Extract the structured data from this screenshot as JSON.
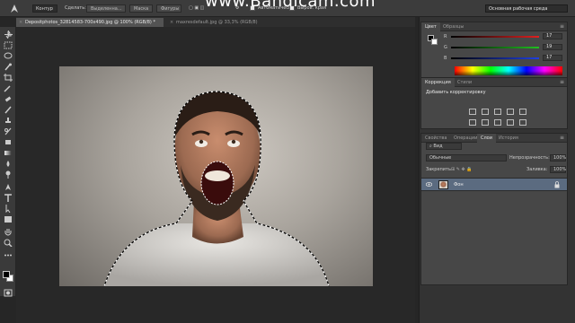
{
  "watermark": "www.Bandicam.com",
  "options_bar": {
    "mode_value": "Контур",
    "make_label": "Сделать:",
    "selection_btn": "Выделенна...",
    "mask_btn": "Маска",
    "shape_btn": "Фигуры",
    "autoadd_label": "Автоматически",
    "align_edges_label": "Выров. края",
    "workspace_value": "Основная рабочая среда"
  },
  "doc_tabs": [
    {
      "label": "Depositphotos_32814583-700x490.jpg @ 100% (RGB/8) *",
      "close": "×"
    },
    {
      "label": "maxresdefault.jpg @ 33,3% (RGB/8)",
      "close": "×"
    }
  ],
  "color_panel": {
    "tabs": [
      "Цвет",
      "Образцы"
    ],
    "channels": [
      {
        "name": "R",
        "value": "17",
        "color": "#e02020"
      },
      {
        "name": "G",
        "value": "19",
        "color": "#20c020"
      },
      {
        "name": "B",
        "value": "17",
        "color": "#2040e0"
      }
    ]
  },
  "adjustments_panel": {
    "tabs": [
      "Коррекция",
      "Стили"
    ],
    "title": "Добавить корректировку"
  },
  "layers_panel": {
    "tabs": [
      "Свойства",
      "Операции",
      "Слои",
      "История"
    ],
    "kind_filter": "Вид",
    "blend_mode": "Обычные",
    "opacity_label": "Непрозрачность:",
    "opacity_value": "100%",
    "lock_label": "Закрепить:",
    "fill_label": "Заливка:",
    "fill_value": "100%",
    "layers": [
      {
        "name": "Фон",
        "visible": true,
        "locked": true
      }
    ]
  },
  "colors": {
    "foreground": "#000000",
    "background": "#ffffff",
    "active_layer": "#5b6b80"
  }
}
